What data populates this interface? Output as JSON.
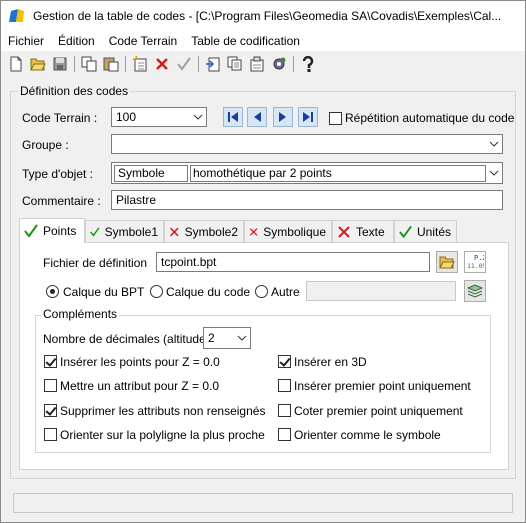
{
  "window": {
    "title": "Gestion de la table de codes - [C:\\Program Files\\Geomedia SA\\Covadis\\Exemples\\Cal..."
  },
  "menu": [
    "Fichier",
    "Édition",
    "Code Terrain",
    "Table de codification"
  ],
  "toolbar": [
    "new-icon",
    "open-icon",
    "save-icon",
    "copy-icon",
    "paste-icon",
    "add-row-icon",
    "delete-icon",
    "validate-icon",
    "import-icon",
    "duplicate-icon",
    "properties-icon",
    "settings-icon",
    "help-icon"
  ],
  "definition": {
    "legend": "Définition des codes",
    "code_terrain_label": "Code Terrain :",
    "code_terrain_value": "100",
    "repetition_label": "Répétition automatique du code",
    "groupe_label": "Groupe :",
    "groupe_value": "",
    "type_objet_label": "Type d'objet :",
    "type_objet_value": "Symbole",
    "type_objet_detail": "homothétique par 2 points",
    "commentaire_label": "Commentaire :",
    "commentaire_value": "Pilastre"
  },
  "tabs": [
    {
      "label": "Points",
      "status": "ok"
    },
    {
      "label": "Symbole1",
      "status": "ok"
    },
    {
      "label": "Symbole2",
      "status": "error"
    },
    {
      "label": "Symbolique",
      "status": "error"
    },
    {
      "label": "Texte",
      "status": "error"
    },
    {
      "label": "Unités",
      "status": "ok"
    }
  ],
  "points_tab": {
    "fichier_label": "Fichier de définition",
    "fichier_value": "tcpoint.bpt",
    "pt_icon_text": "P.2\n11.05",
    "radios": [
      "Calque du BPT",
      "Calque du code",
      "Autre"
    ],
    "selected_radio": 0,
    "autre_value": "",
    "complements_legend": "Compléments",
    "decimales_label": "Nombre de décimales (altitude)",
    "decimales_value": "2",
    "options_left": [
      {
        "label": "Insérer les points pour Z = 0.0",
        "checked": true
      },
      {
        "label": "Mettre un attribut pour Z = 0.0",
        "checked": false
      },
      {
        "label": "Supprimer les attributs non renseignés",
        "checked": true
      },
      {
        "label": "Orienter sur la polyligne la plus proche",
        "checked": false
      }
    ],
    "options_right": [
      {
        "label": "Insérer en 3D",
        "checked": true
      },
      {
        "label": "Insérer premier point uniquement",
        "checked": false
      },
      {
        "label": "Coter premier point uniquement",
        "checked": false
      },
      {
        "label": "Orienter comme le symbole",
        "checked": false
      }
    ]
  },
  "colors": {
    "ok": "#1a8f1a",
    "error": "#d11c1c",
    "nav": "#1a3f99",
    "titlebar": "#ffffff"
  }
}
